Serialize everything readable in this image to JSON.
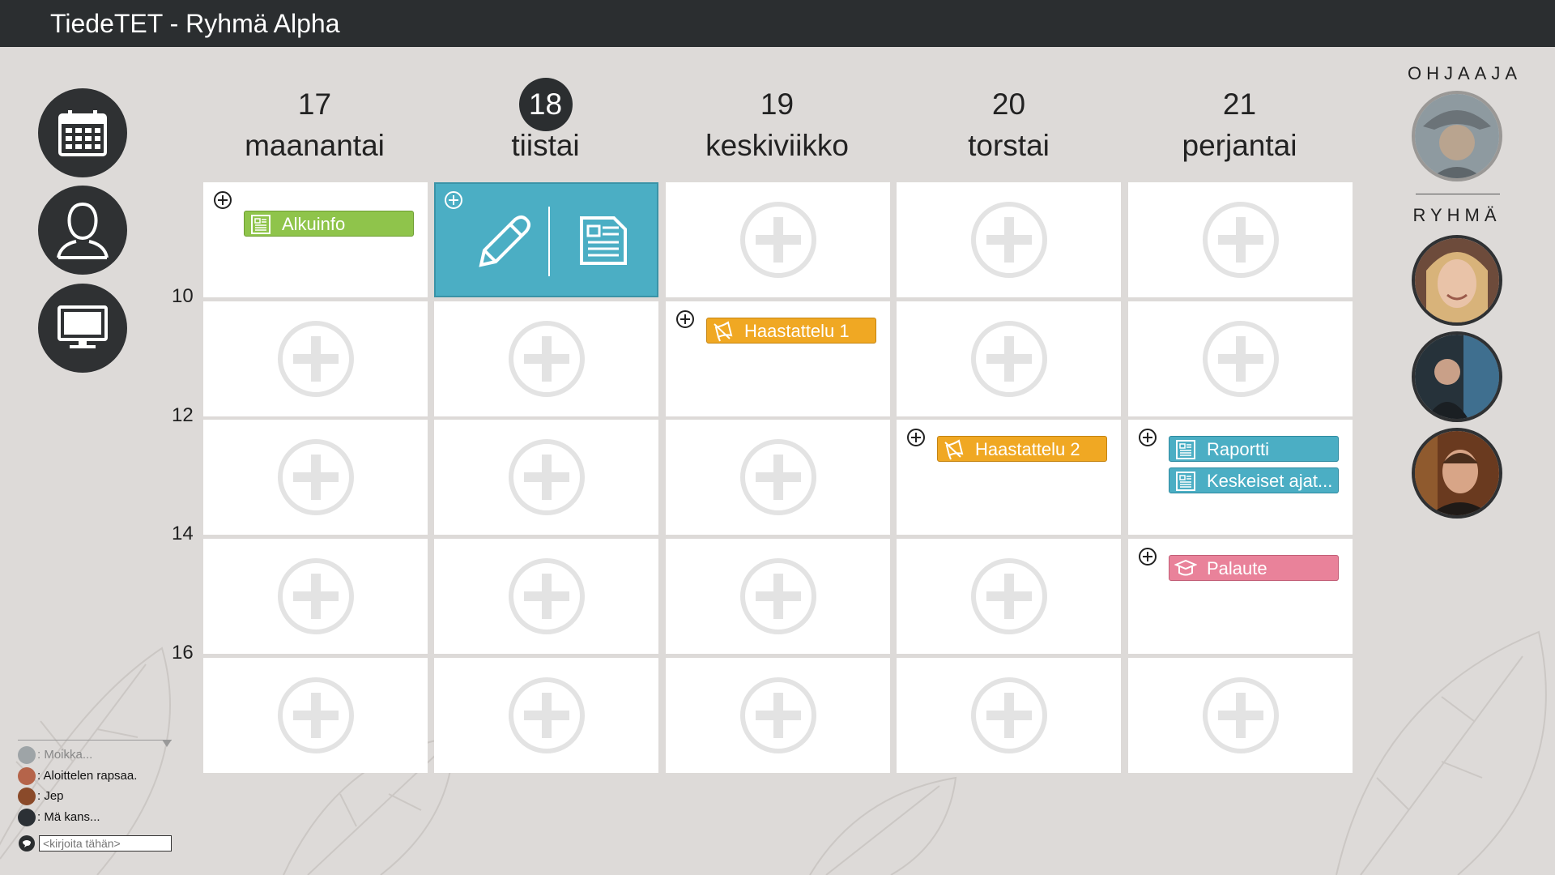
{
  "app": {
    "title": "TiedeTET - Ryhmä Alpha"
  },
  "nav": [
    {
      "name": "calendar",
      "icon": "calendar-icon"
    },
    {
      "name": "profile",
      "icon": "user-icon"
    },
    {
      "name": "screen",
      "icon": "monitor-icon"
    }
  ],
  "days": [
    {
      "num": "17",
      "name": "maanantai",
      "today": false
    },
    {
      "num": "18",
      "name": "tiistai",
      "today": true
    },
    {
      "num": "19",
      "name": "keskiviikko",
      "today": false
    },
    {
      "num": "20",
      "name": "torstai",
      "today": false
    },
    {
      "num": "21",
      "name": "perjantai",
      "today": false
    }
  ],
  "hours": [
    "10",
    "12",
    "14",
    "16"
  ],
  "events": {
    "alkuinfo": {
      "label": "Alkuinfo",
      "icon": "document-icon",
      "color": "#8fc44b"
    },
    "haastattelu1": {
      "label": "Haastattelu 1",
      "icon": "megaphone-icon",
      "color": "#f0a823"
    },
    "haastattelu2": {
      "label": "Haastattelu 2",
      "icon": "megaphone-icon",
      "color": "#f0a823"
    },
    "raportti": {
      "label": "Raportti",
      "icon": "document-icon",
      "color": "#4baec4"
    },
    "keskeiset": {
      "label": "Keskeiset ajat...",
      "icon": "document-icon",
      "color": "#4baec4"
    },
    "palaute": {
      "label": "Palaute",
      "icon": "graduation-cap-icon",
      "color": "#e9829a"
    }
  },
  "selected_cell": {
    "tools": [
      "pencil-icon",
      "document-icon"
    ]
  },
  "right_panel": {
    "supervisor_label": "OHJAAJA",
    "group_label": "RYHMÄ"
  },
  "chat": {
    "messages": [
      {
        "text": ": Moikka..."
      },
      {
        "text": ": Aloittelen rapsaa."
      },
      {
        "text": ": Jep"
      },
      {
        "text": ": Mä kans..."
      }
    ],
    "placeholder": "<kirjoita tähän>"
  }
}
